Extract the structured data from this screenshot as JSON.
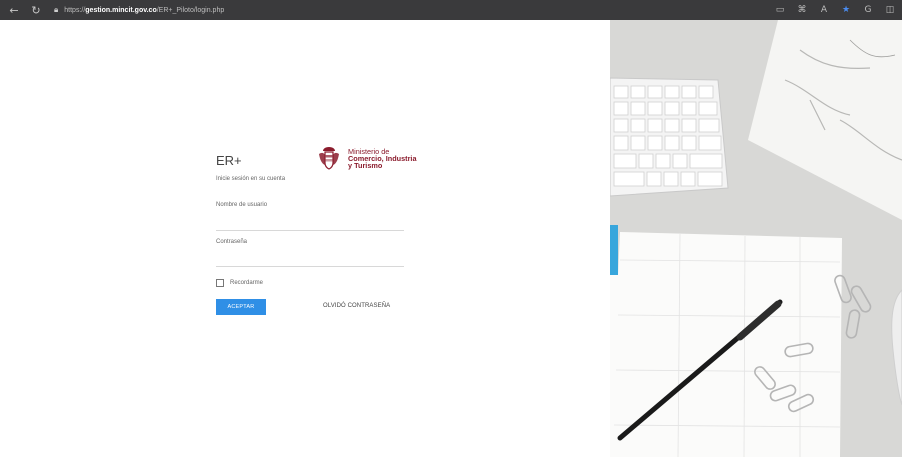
{
  "browser": {
    "url_prefix": "https://",
    "url_domain": "gestion.mincit.gov.co",
    "url_path": "/ER+_Piloto/login.php"
  },
  "login": {
    "app_title": "ER+",
    "subtitle": "Inicie sesión en su cuenta",
    "logo": {
      "line1": "Ministerio de",
      "line2": "Comercio, Industria",
      "line3": "y Turismo"
    },
    "username_label": "Nombre de usuario",
    "password_label": "Contraseña",
    "remember_label": "Recordarme",
    "accept_button": "ACEPTAR",
    "forgot_link": "OLVIDÓ CONTRASEÑA"
  },
  "colors": {
    "accent": "#2f8fe6",
    "brand": "#8b1c2d",
    "browser_bar": "#3a3a3c"
  },
  "icons": [
    "back-arrow-icon",
    "refresh-icon",
    "lock-icon",
    "favorites-star-icon",
    "coat-of-arms-icon"
  ]
}
